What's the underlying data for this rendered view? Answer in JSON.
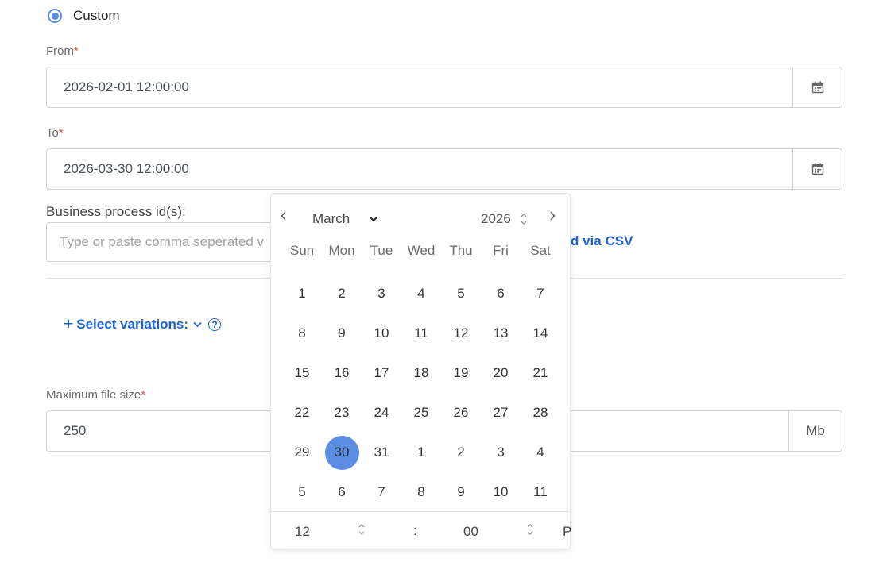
{
  "radio": {
    "label": "Custom",
    "selected": true,
    "accent": "#5a8de0"
  },
  "from": {
    "label": "From",
    "required_mark": "*",
    "value": "2026-02-01 12:00:00",
    "icon": "calendar-icon"
  },
  "to": {
    "label": "To",
    "required_mark": "*",
    "value": "2026-03-30 12:00:00",
    "icon": "calendar-icon"
  },
  "business_process": {
    "label": "Business process id(s):",
    "placeholder": "Type or paste comma seperated v",
    "csv_link": "d via CSV"
  },
  "variations": {
    "plus": "+",
    "label": "Select variations:",
    "help": "?"
  },
  "max_file_size": {
    "label": "Maximum file size",
    "required_mark": "*",
    "value": "250",
    "unit": "Mb"
  },
  "datepicker": {
    "prev": "‹",
    "next": "›",
    "month": "March",
    "year": "2026",
    "weekdays": [
      "Sun",
      "Mon",
      "Tue",
      "Wed",
      "Thu",
      "Fri",
      "Sat"
    ],
    "days": [
      "1",
      "2",
      "3",
      "4",
      "5",
      "6",
      "7",
      "8",
      "9",
      "10",
      "11",
      "12",
      "13",
      "14",
      "15",
      "16",
      "17",
      "18",
      "19",
      "20",
      "21",
      "22",
      "23",
      "24",
      "25",
      "26",
      "27",
      "28",
      "29",
      "30",
      "31",
      "1",
      "2",
      "3",
      "4",
      "5",
      "6",
      "7",
      "8",
      "9",
      "10",
      "11"
    ],
    "selected_index": 29,
    "selected_color": "#5b8ee0",
    "time": {
      "hour": "12",
      "separator": ":",
      "minute": "00",
      "ampm": "P"
    }
  }
}
